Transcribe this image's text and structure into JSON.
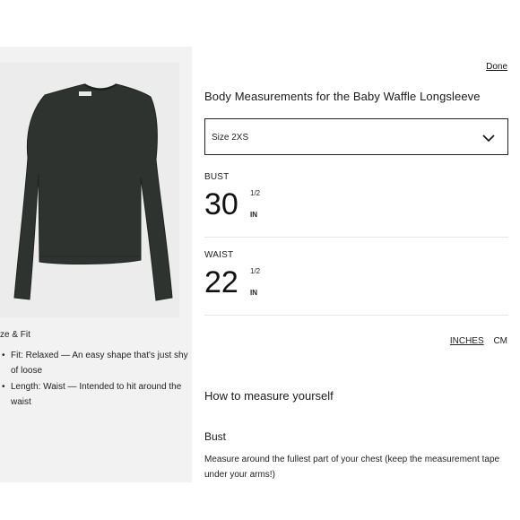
{
  "fit_panel": {
    "section_title": "ze & Fit",
    "items": [
      "Fit: Relaxed — An easy shape that's just shy of loose",
      "Length: Waist — Intended to hit around the waist"
    ]
  },
  "modal": {
    "done_label": "Done",
    "title": "Body Measurements for the Baby Waffle Longsleeve",
    "size_select": {
      "value": "Size 2XS"
    },
    "measurements": [
      {
        "label": "BUST",
        "value": "30",
        "fraction": "1/2",
        "unit": "IN"
      },
      {
        "label": "WAIST",
        "value": "22",
        "fraction": "1/2",
        "unit": "IN"
      }
    ],
    "units": {
      "inches": "INCHES",
      "cm": "CM",
      "selected": "INCHES"
    },
    "how_to": {
      "title": "How to measure yourself",
      "bust_title": "Bust",
      "bust_description": "Measure around the fullest part of your chest (keep the measurement tape under your arms!)"
    }
  }
}
